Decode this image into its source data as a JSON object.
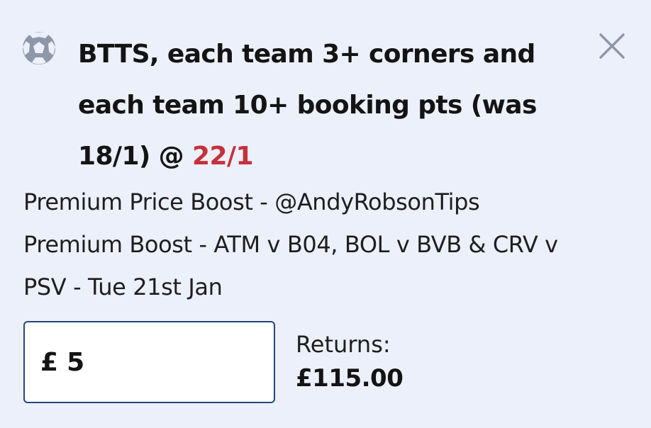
{
  "selection": {
    "title_main": "BTTS, each team 3+ corners and each team 10+ booking pts (was 18/1) @ ",
    "odds": "22/1"
  },
  "market": {
    "line1": "Premium Price Boost - @AndyRobsonTips",
    "line2": "Premium Boost - ATM v B04, BOL v BVB & CRV v",
    "line3": "PSV - Tue 21st Jan"
  },
  "stake": {
    "currency": "£",
    "value": "5"
  },
  "returns": {
    "label": "Returns:",
    "value": "£115.00"
  },
  "icons": {
    "sport": "football-icon",
    "close": "close-icon"
  },
  "colors": {
    "background": "#ecf0fa",
    "odds": "#c5313c",
    "input_border": "#26457c",
    "icon": "#8e97a8"
  }
}
